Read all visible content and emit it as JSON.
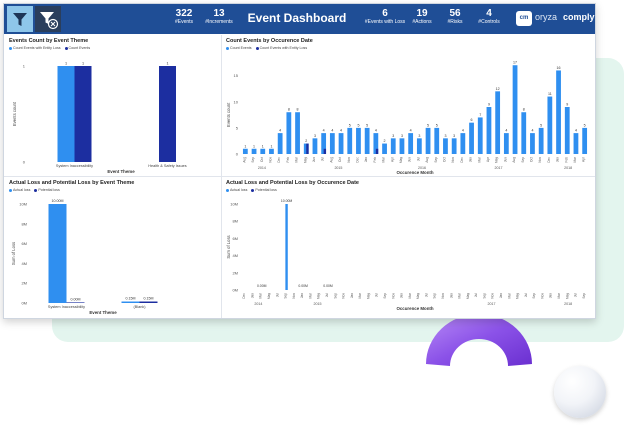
{
  "header": {
    "title": "Event Dashboard",
    "kpis": [
      {
        "value": "322",
        "label": "#Events"
      },
      {
        "value": "13",
        "label": "#Increments"
      },
      {
        "value": "6",
        "label": "#Events with Loss"
      },
      {
        "value": "19",
        "label": "#Actions"
      },
      {
        "value": "56",
        "label": "#Risks"
      },
      {
        "value": "4",
        "label": "#Controls"
      }
    ],
    "logo": {
      "mark": "cm",
      "word1": "oryza",
      "word2": "comply"
    }
  },
  "colors": {
    "primary": "#1f4e96",
    "series_light": "#2f8ff0",
    "series_dark": "#1c2ea0",
    "mint": "#e3f5ee",
    "arch": "#8b52e8"
  },
  "icons": {
    "filter": "filter-icon",
    "clear_filter": "clear-filter-icon"
  },
  "chart_data": [
    {
      "id": "count-by-theme",
      "type": "bar",
      "title": "Events Count by Event Theme",
      "legend": [
        "Count Events with Entity Loss",
        "Count Events"
      ],
      "xlabel": "Event Theme",
      "ylabel": "Events count",
      "categories": [
        "System Inaccessibility",
        "Health & Safety Issues"
      ],
      "series": [
        {
          "name": "Count Events with Entity Loss",
          "values": [
            1,
            null
          ]
        },
        {
          "name": "Count Events",
          "values": [
            1,
            1
          ]
        }
      ],
      "yticks": [
        "1",
        "0"
      ],
      "ylim": [
        0,
        1
      ]
    },
    {
      "id": "count-by-date",
      "type": "bar",
      "title": "Count Events by Occurence Date",
      "legend": [
        "Count Events",
        "Count Events with Entity Loss"
      ],
      "xlabel": "Occurence Month",
      "ylabel": "Events count",
      "yticks": [
        "15",
        "10",
        "5",
        "0"
      ],
      "ylim": [
        0,
        18
      ],
      "years": [
        "2014",
        "2015",
        "2016",
        "2017",
        "2018"
      ],
      "series": [
        {
          "name": "Count Events",
          "values": [
            1,
            1,
            1,
            1,
            4,
            8,
            8,
            2,
            3,
            4,
            4,
            4,
            5,
            5,
            5,
            4,
            2,
            3,
            3,
            4,
            3,
            5,
            5,
            3,
            3,
            4,
            6,
            7,
            9,
            12,
            4,
            17,
            8,
            4,
            5,
            11,
            16,
            9,
            4,
            5
          ]
        },
        {
          "name": "Count Events with Entity Loss",
          "values": [
            0,
            0,
            0,
            0,
            0,
            0,
            0,
            2,
            0,
            1,
            0,
            0,
            0,
            0,
            0,
            1,
            0,
            0,
            0,
            0,
            0,
            0,
            0,
            0,
            0,
            0,
            0,
            0,
            0,
            0,
            0,
            0,
            0,
            0,
            0,
            0,
            0,
            0,
            0,
            0
          ]
        }
      ]
    },
    {
      "id": "loss-by-theme",
      "type": "bar",
      "title": "Actual Loss and Potential Loss by Event Theme",
      "legend": [
        "Actual loss",
        "Potential loss"
      ],
      "xlabel": "Event Theme",
      "ylabel": "Sum of Loss",
      "categories": [
        "System Inaccessibility",
        "(Blank)"
      ],
      "series": [
        {
          "name": "Actual loss",
          "values": [
            10000000,
            150000
          ]
        },
        {
          "name": "Potential loss",
          "values": [
            0,
            150000
          ]
        }
      ],
      "data_labels": [
        "10.00M",
        "0.00M",
        "0.15M",
        "0.15M"
      ],
      "yticks": [
        "10M",
        "8M",
        "6M",
        "4M",
        "2M",
        "0M"
      ],
      "ylim": [
        0,
        10000000
      ]
    },
    {
      "id": "loss-by-date",
      "type": "bar",
      "title": "Actual Loss and Potential Loss by Occurence Date",
      "legend": [
        "Actual loss",
        "Potential loss"
      ],
      "xlabel": "Occurence Month",
      "ylabel": "Sum of Loss",
      "yticks": [
        "10M",
        "8M",
        "6M",
        "4M",
        "2M",
        "0M"
      ],
      "ylim": [
        0,
        10000000
      ],
      "years": [
        "2014",
        "2015",
        "2017",
        "2018"
      ],
      "months": [
        "Dec",
        "Jan",
        "Mar",
        "May",
        "Jul",
        "Sep",
        "Nov",
        "Jan",
        "Mar",
        "May",
        "Jul",
        "Sep",
        "Nov",
        "Jan",
        "Mar",
        "May",
        "Jul",
        "Sep",
        "Nov",
        "Jan",
        "Mar",
        "May",
        "Jul",
        "Sep",
        "Nov",
        "Jan",
        "Mar",
        "May",
        "Jul",
        "Sep",
        "Nov",
        "Jan",
        "Mar",
        "May",
        "Jul",
        "Sep",
        "Nov",
        "Jan",
        "Mar",
        "May",
        "Jul",
        "Sep"
      ],
      "series": [
        {
          "name": "Actual loss",
          "values": [
            0,
            0,
            0,
            0,
            0,
            10000000,
            0,
            0,
            0,
            0,
            0,
            0,
            0,
            0,
            0,
            0,
            0,
            0,
            0,
            0,
            0,
            0,
            0,
            0,
            0,
            0,
            0,
            0,
            0,
            0,
            0,
            0,
            0,
            0,
            0,
            0,
            0,
            0,
            0,
            0,
            0,
            0
          ]
        },
        {
          "name": "Potential loss",
          "values": [
            0,
            0,
            0,
            0,
            0,
            0,
            0,
            0,
            0,
            0,
            0,
            0,
            0,
            0,
            0,
            0,
            0,
            0,
            0,
            0,
            0,
            0,
            0,
            0,
            0,
            0,
            0,
            0,
            0,
            0,
            0,
            0,
            0,
            0,
            0,
            0,
            0,
            0,
            0,
            0,
            0,
            0
          ]
        }
      ],
      "data_labels": [
        "0.00M",
        "10.00M",
        "0.00M",
        "0.00M"
      ]
    }
  ],
  "month_ticks_count": [
    "Aug",
    "Sep",
    "Oct",
    "Nov",
    "Dec",
    "Feb",
    "Mar",
    "May",
    "Jun",
    "Jul",
    "Aug",
    "Oct",
    "Nov",
    "Dec",
    "Jan",
    "Feb",
    "Mar",
    "Apr",
    "May",
    "Jun",
    "Jul",
    "Aug",
    "Sep",
    "Oct",
    "Nov",
    "Dec",
    "Jan",
    "Mar",
    "Apr",
    "May",
    "Jun",
    "Aug",
    "Sep",
    "Oct",
    "Nov",
    "Dec",
    "Jan",
    "Feb",
    "Mar",
    "Apr"
  ]
}
